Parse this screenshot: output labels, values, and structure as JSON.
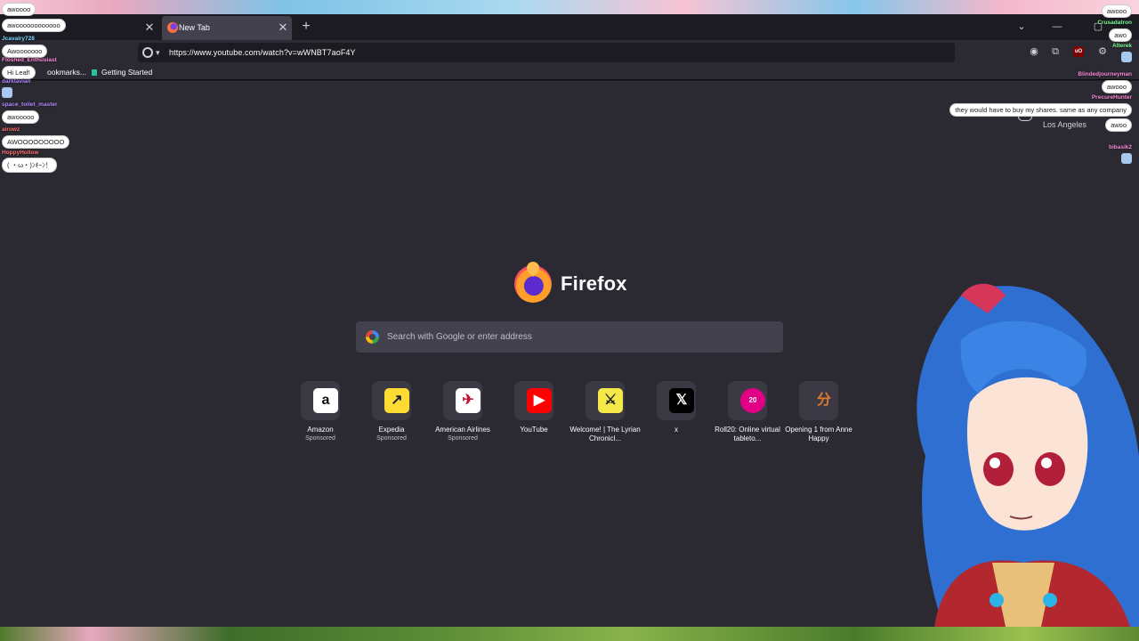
{
  "tabs": [
    {
      "title": ""
    },
    {
      "title": "New Tab"
    }
  ],
  "nav": {
    "url": "https://www.youtube.com/watch?v=wWNBT7aoF4Y"
  },
  "bookmarks": [
    {
      "label": "ookmarks..."
    },
    {
      "label": "Getting Started"
    }
  ],
  "newtab": {
    "brand": "Firefox",
    "search_placeholder": "Search with Google or enter address",
    "weather_location": "Los Angeles",
    "top_sites": [
      {
        "label": "Amazon",
        "sponsored": "Sponsored",
        "glyph": "a",
        "bg": "#ffffff",
        "fg": "#111111"
      },
      {
        "label": "Expedia",
        "sponsored": "Sponsored",
        "glyph": "↗",
        "bg": "#fddb32",
        "fg": "#191e3b"
      },
      {
        "label": "American Airlines",
        "sponsored": "Sponsored",
        "glyph": "✈",
        "bg": "#ffffff",
        "fg": "#c8102e"
      },
      {
        "label": "YouTube",
        "sponsored": "",
        "glyph": "▶",
        "bg": "#ff0000",
        "fg": "#ffffff"
      },
      {
        "label": "Welcome! | The Lyrian Chronicl...",
        "sponsored": "",
        "glyph": "⚔",
        "bg": "#f5e94a",
        "fg": "#222222"
      },
      {
        "label": "x",
        "sponsored": "",
        "glyph": "𝕏",
        "bg": "#000000",
        "fg": "#ffffff"
      },
      {
        "label": "Roll20: Online virtual tableto...",
        "sponsored": "",
        "glyph": "20",
        "bg": "#e10085",
        "fg": "#ffffff"
      },
      {
        "label": "Opening 1 from Anne Happy",
        "sponsored": "",
        "glyph": "分",
        "bg": "#3a3944",
        "fg": "#e07a2c"
      }
    ]
  },
  "overlay_chat_left": [
    {
      "name": "",
      "message": "awoooo",
      "color": "#7fdcff"
    },
    {
      "name": "",
      "message": "awoooooooooooo",
      "color": "#7fdcff"
    },
    {
      "name": "Jcavalry728",
      "message": "Awooooooo",
      "color": "#7fdcff"
    },
    {
      "name": "Floshed_Enthusiast",
      "message": "Hi Leaf!",
      "color": "#ff8ad8"
    },
    {
      "name": "darktavian",
      "message": "",
      "color": "#b58aff"
    },
    {
      "name": "space_toilet_master",
      "message": "awooooo",
      "color": "#b58aff"
    },
    {
      "name": "airowz",
      "message": "AWOOOOOOOOO",
      "color": "#ff7070"
    },
    {
      "name": "HoppyHollow",
      "message": "( ・ω・)ﾝｷｰﾝ！",
      "color": "#ff7070"
    }
  ],
  "overlay_chat_right": [
    {
      "name": "",
      "message": "awooo",
      "color": "#7fdcff"
    },
    {
      "name": "Crusadatron",
      "message": "awo",
      "color": "#7fff9a"
    },
    {
      "name": "Alterek",
      "message": "",
      "color": "#7fff9a"
    },
    {
      "name": "Blindedjourneyman",
      "message": "awooo",
      "color": "#ff8ad8"
    },
    {
      "name": "PrecureHunter",
      "message": "they would have to buy my shares. same as any company",
      "color": "#ff8ad8"
    },
    {
      "name": "",
      "message": "awoo",
      "color": "#7fff9a"
    },
    {
      "name": "bibasik2",
      "message": "",
      "color": "#ff8ad8"
    }
  ]
}
